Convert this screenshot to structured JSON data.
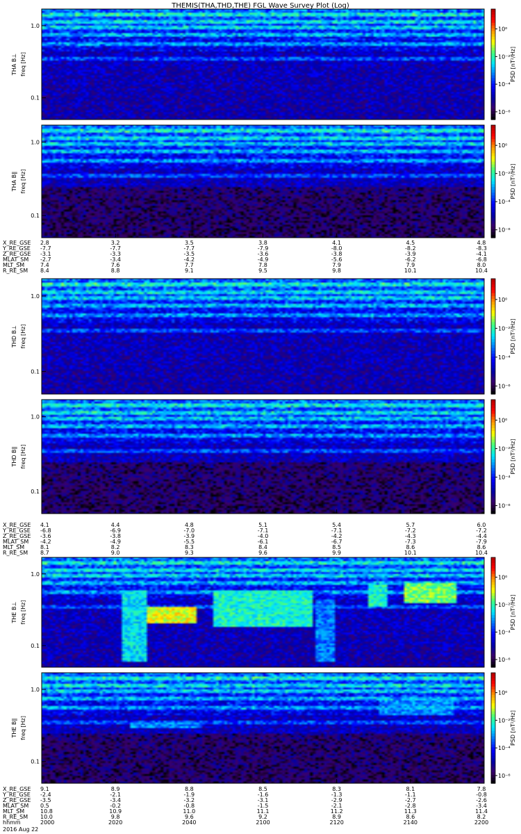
{
  "chart_data": {
    "type": "heatmap",
    "title": "THEMIS(THA,THD,THE) FGL Wave Survey Plot (Log)",
    "colorbar": {
      "label": "PSD [nT²/Hz]",
      "tick_labels": [
        "10⁰",
        "10⁻²",
        "10⁻⁴",
        "10⁻⁶"
      ],
      "colormap": [
        "#000000",
        "#3b006b",
        "#0000a8",
        "#0000ff",
        "#0070ff",
        "#00e5ff",
        "#40ff80",
        "#ffff00",
        "#ff9900",
        "#ff0000",
        "#b00000"
      ]
    },
    "freq_ticks": [
      "1.0",
      "0.1"
    ],
    "panels": [
      {
        "probe": "THA",
        "component": "perp",
        "label": "THA B⊥",
        "ylabel": "freq [Hz]"
      },
      {
        "probe": "THA",
        "component": "par",
        "label": "THA B∥",
        "ylabel": "freq [Hz]"
      },
      {
        "probe": "THD",
        "component": "perp",
        "label": "THD B⊥",
        "ylabel": "freq [Hz]"
      },
      {
        "probe": "THD",
        "component": "par",
        "label": "THD B∥",
        "ylabel": "freq [Hz]"
      },
      {
        "probe": "THE",
        "component": "perp",
        "label": "THE B⊥",
        "ylabel": "freq [Hz]"
      },
      {
        "probe": "THE",
        "component": "par",
        "label": "THE B∥",
        "ylabel": "freq [Hz]"
      }
    ],
    "ephemeris": [
      {
        "probe": "THA",
        "rows": [
          {
            "name": "X_RE_GSE",
            "values": [
              "2.8",
              "3.2",
              "3.5",
              "3.8",
              "4.1",
              "4.5",
              "4.8"
            ]
          },
          {
            "name": "Y_RE_GSE",
            "values": [
              "-7.7",
              "-7.7",
              "-7.7",
              "-7.9",
              "-8.0",
              "-8.2",
              "-8.3"
            ]
          },
          {
            "name": "Z_RE_GSE",
            "values": [
              "-3.1",
              "-3.3",
              "-3.5",
              "-3.6",
              "-3.8",
              "-3.9",
              "-4.1"
            ]
          },
          {
            "name": "MLAT_SM",
            "values": [
              "-2.7",
              "-3.4",
              "-4.2",
              "-4.9",
              "-5.6",
              "-6.2",
              "-6.8"
            ]
          },
          {
            "name": "MLT_SM",
            "values": [
              "7.4",
              "7.6",
              "7.7",
              "7.8",
              "7.9",
              "7.9",
              "8.0"
            ]
          },
          {
            "name": "R_RE_SM",
            "values": [
              "8.4",
              "8.8",
              "9.1",
              "9.5",
              "9.8",
              "10.1",
              "10.4"
            ]
          }
        ]
      },
      {
        "probe": "THD",
        "rows": [
          {
            "name": "X_RE_GSE",
            "values": [
              "4.1",
              "4.4",
              "4.8",
              "5.1",
              "5.4",
              "5.7",
              "6.0"
            ]
          },
          {
            "name": "Y_RE_GSE",
            "values": [
              "-6.8",
              "-6.9",
              "-7.0",
              "-7.1",
              "-7.1",
              "-7.2",
              "-7.2"
            ]
          },
          {
            "name": "Z_RE_GSE",
            "values": [
              "-3.6",
              "-3.8",
              "-3.9",
              "-4.0",
              "-4.2",
              "-4.3",
              "-4.4"
            ]
          },
          {
            "name": "MLAT_SM",
            "values": [
              "-4.2",
              "-4.9",
              "-5.5",
              "-6.1",
              "-6.7",
              "-7.3",
              "-7.9"
            ]
          },
          {
            "name": "MLT_SM",
            "values": [
              "8.1",
              "8.2",
              "8.3",
              "8.4",
              "8.5",
              "8.6",
              "8.6"
            ]
          },
          {
            "name": "R_RE_SM",
            "values": [
              "8.7",
              "9.0",
              "9.3",
              "9.6",
              "9.9",
              "10.1",
              "10.4"
            ]
          }
        ]
      },
      {
        "probe": "THE",
        "rows": [
          {
            "name": "X_RE_GSE",
            "values": [
              "9.1",
              "8.9",
              "8.8",
              "8.5",
              "8.3",
              "8.1",
              "7.8"
            ]
          },
          {
            "name": "Y_RE_GSE",
            "values": [
              "-2.4",
              "-2.1",
              "-1.9",
              "-1.6",
              "-1.3",
              "-1.1",
              "-0.8"
            ]
          },
          {
            "name": "Z_RE_GSE",
            "values": [
              "-3.5",
              "-3.4",
              "-3.2",
              "-3.1",
              "-2.9",
              "-2.7",
              "-2.6"
            ]
          },
          {
            "name": "MLAT_SM",
            "values": [
              "0.5",
              "-0.2",
              "-0.8",
              "-1.5",
              "-2.1",
              "-2.8",
              "-3.4"
            ]
          },
          {
            "name": "MLT_SM",
            "values": [
              "10.8",
              "10.9",
              "11.0",
              "11.1",
              "11.2",
              "11.3",
              "11.4"
            ]
          },
          {
            "name": "R_RE_SM",
            "values": [
              "10.0",
              "9.8",
              "9.6",
              "9.2",
              "8.9",
              "8.6",
              "8.2"
            ]
          },
          {
            "name": "hhmm",
            "values": [
              "2000",
              "2020",
              "2040",
              "2100",
              "2120",
              "2140",
              "2200"
            ]
          }
        ]
      }
    ],
    "date_label": "2016 Aug 22",
    "x_ticks_hhmm": [
      "2000",
      "2020",
      "2040",
      "2100",
      "2120",
      "2140",
      "2200"
    ],
    "bright_bands_hz": [
      1.4,
      1.15,
      0.95,
      0.75,
      0.55,
      0.35
    ],
    "wave_events": [
      {
        "panel": 4,
        "t": [
          0.18,
          0.24
        ],
        "f": [
          0.06,
          0.6
        ],
        "level": 0.58
      },
      {
        "panel": 4,
        "t": [
          0.24,
          0.35
        ],
        "f": [
          0.2,
          0.34
        ],
        "level": 0.78
      },
      {
        "panel": 4,
        "t": [
          0.39,
          0.61
        ],
        "f": [
          0.18,
          0.58
        ],
        "level": 0.62
      },
      {
        "panel": 4,
        "t": [
          0.62,
          0.66
        ],
        "f": [
          0.06,
          0.45
        ],
        "level": 0.48
      },
      {
        "panel": 4,
        "t": [
          0.74,
          0.78
        ],
        "f": [
          0.35,
          0.7
        ],
        "level": 0.62
      },
      {
        "panel": 4,
        "t": [
          0.82,
          0.94
        ],
        "f": [
          0.38,
          0.75
        ],
        "level": 0.7
      },
      {
        "panel": 5,
        "t": [
          0.2,
          0.36
        ],
        "f": [
          0.3,
          0.34
        ],
        "level": 0.5
      },
      {
        "panel": 5,
        "t": [
          0.76,
          0.93
        ],
        "f": [
          0.45,
          0.75
        ],
        "level": 0.5
      }
    ]
  }
}
